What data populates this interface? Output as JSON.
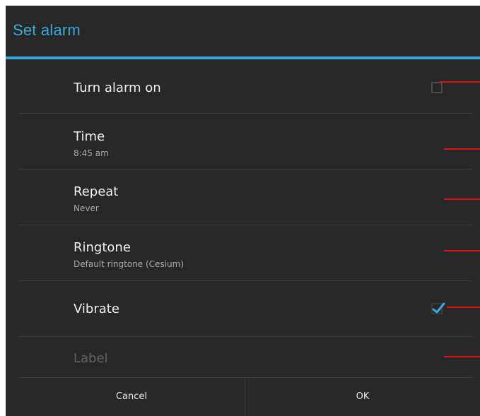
{
  "dialog": {
    "title": "Set alarm",
    "accent_color": "#39a9d8",
    "background_color": "#282828"
  },
  "settings": {
    "alarm_on": {
      "label": "Turn alarm on",
      "checked": false
    },
    "time": {
      "label": "Time",
      "value": "8:45 am"
    },
    "repeat": {
      "label": "Repeat",
      "value": "Never"
    },
    "ringtone": {
      "label": "Ringtone",
      "value": "Default ringtone (Cesium)"
    },
    "vibrate": {
      "label": "Vibrate",
      "checked": true
    },
    "label": {
      "placeholder": "Label",
      "value": ""
    }
  },
  "buttons": {
    "cancel_label": "Cancel",
    "ok_label": "OK"
  },
  "annotation_color": "#e01010"
}
